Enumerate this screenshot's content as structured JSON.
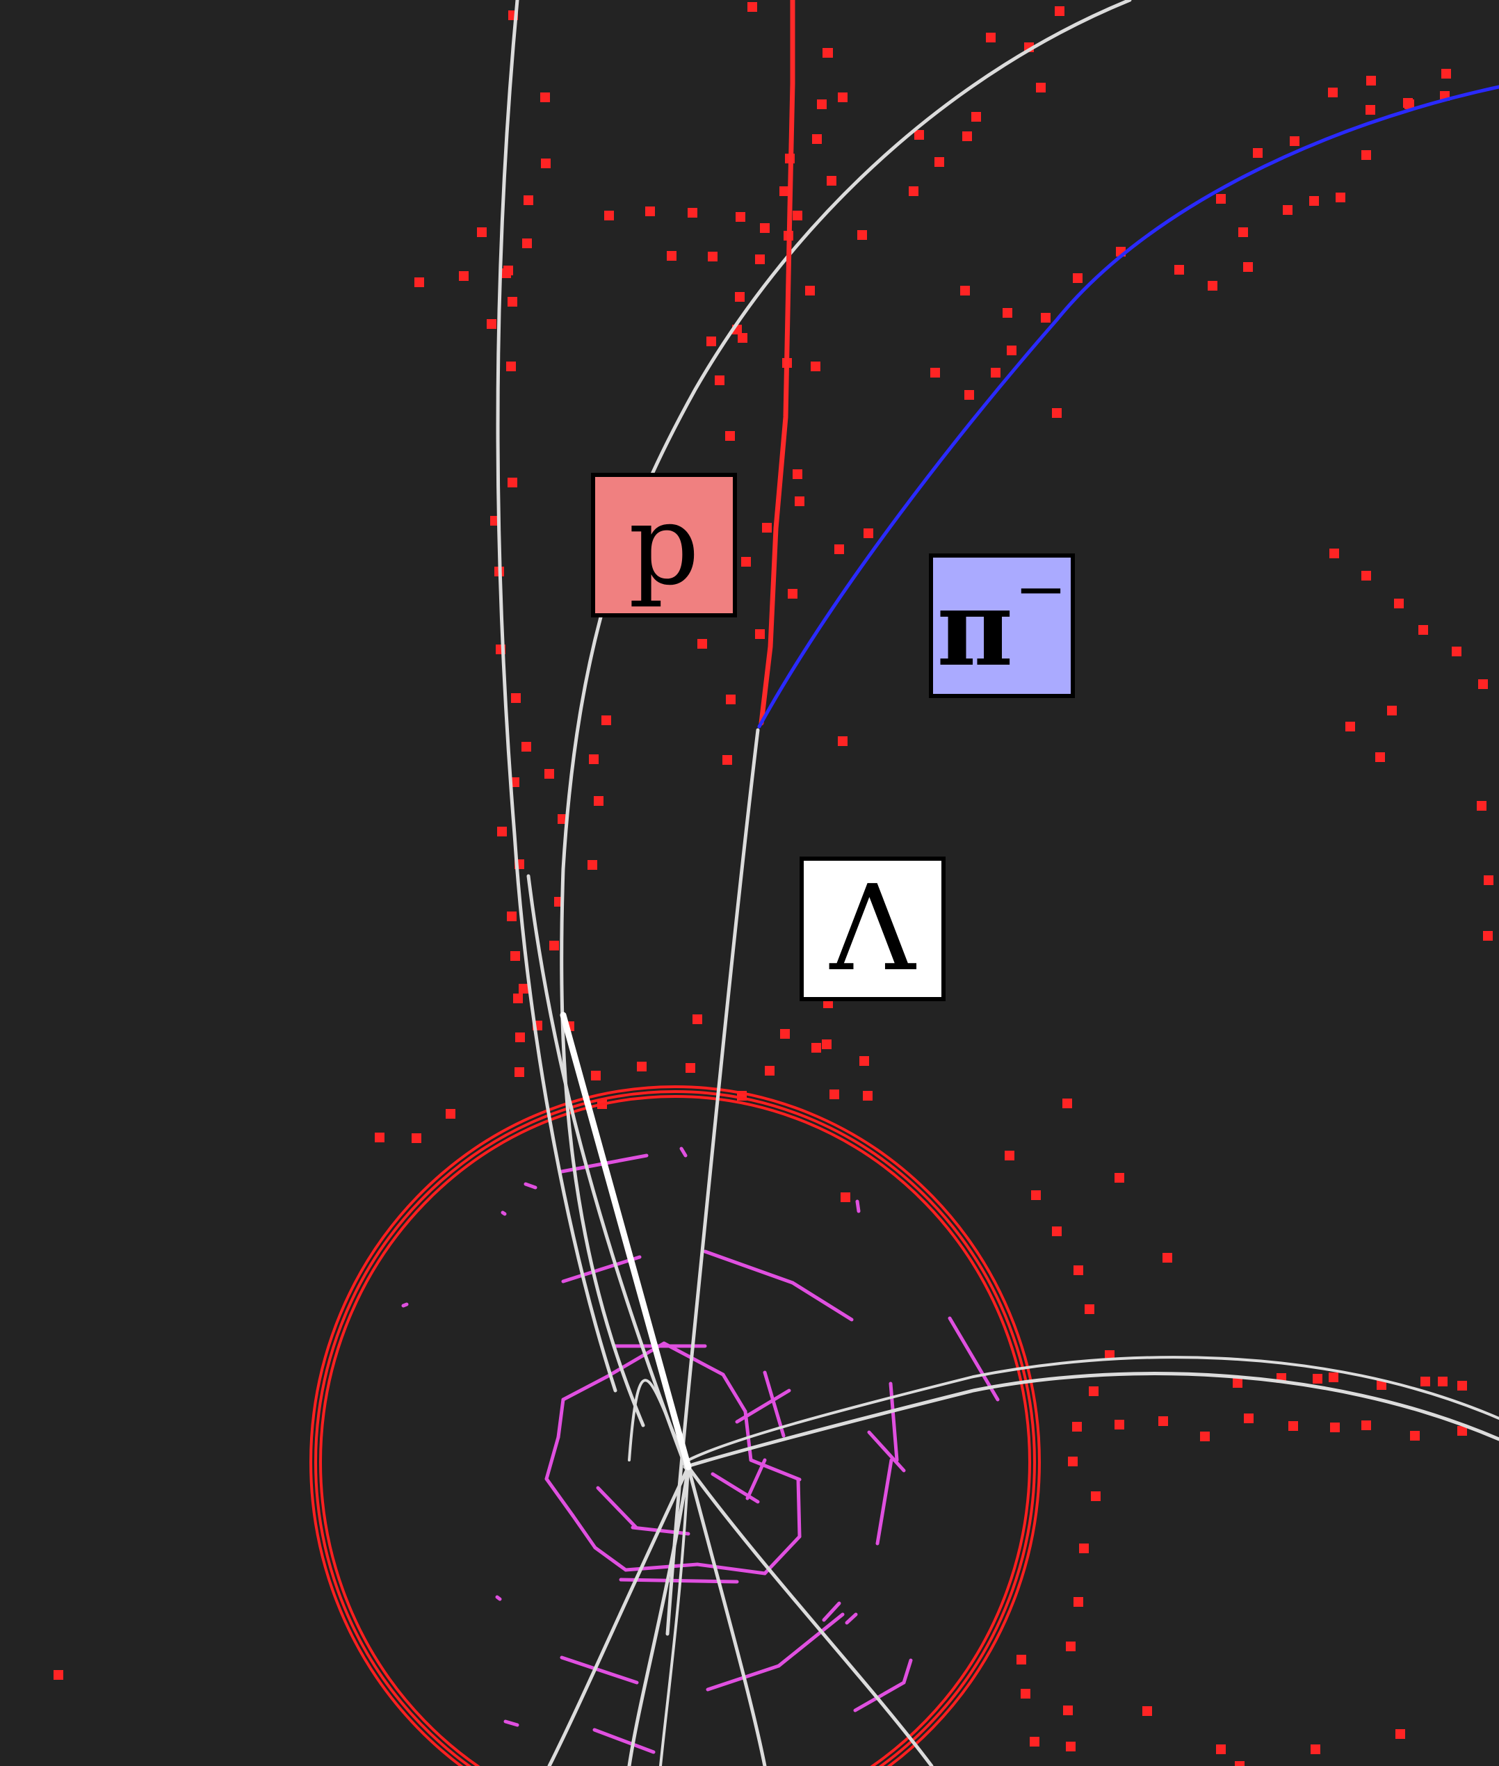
{
  "colors": {
    "background": "#232323",
    "track_white": "#dcdcdc",
    "track_red": "#ff2a2a",
    "track_blue": "#2a2aff",
    "hit_red": "#ff2424",
    "vertex_magenta": "#e050e0",
    "ring_red": "#ff2020"
  },
  "labels": {
    "proton": {
      "symbol": "p",
      "bg": "#f08080"
    },
    "pion": {
      "symbol": "π",
      "superscript": "−",
      "bg": "#aaaaff"
    },
    "lambda": {
      "symbol": "Λ",
      "bg": "#ffffff"
    }
  }
}
